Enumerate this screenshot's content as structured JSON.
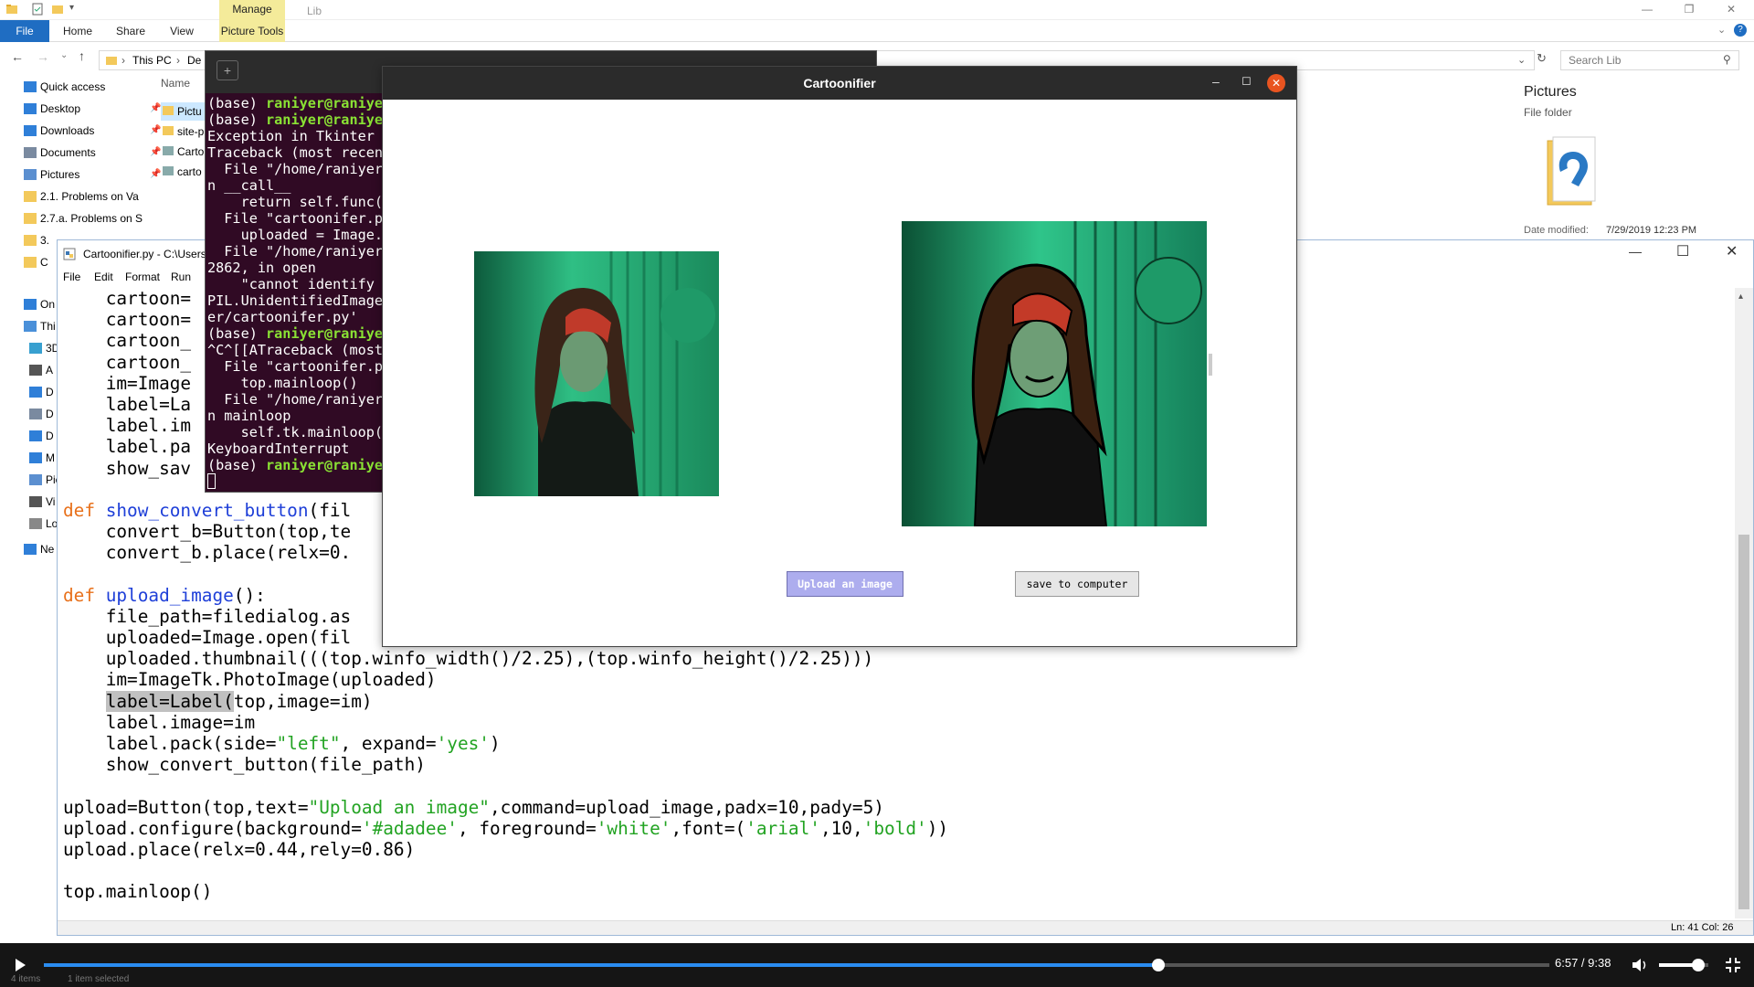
{
  "explorer": {
    "contextual_tab": "Manage",
    "window_title": "Lib",
    "tabs": [
      "File",
      "Home",
      "Share",
      "View",
      "Picture Tools"
    ],
    "breadcrumb": [
      "This PC",
      "De"
    ],
    "search_placeholder": "Search Lib",
    "name_column": "Name",
    "nav_items": [
      {
        "label": "Quick access",
        "icon": "star-icon"
      },
      {
        "label": "Desktop",
        "icon": "desktop-icon"
      },
      {
        "label": "Downloads",
        "icon": "download-icon"
      },
      {
        "label": "Documents",
        "icon": "documents-icon"
      },
      {
        "label": "Pictures",
        "icon": "pictures-icon"
      },
      {
        "label": "2.1. Problems on Va",
        "icon": "folder-icon"
      },
      {
        "label": "2.7.a. Problems on S",
        "icon": "folder-icon"
      },
      {
        "label": "3.",
        "icon": "folder-icon"
      },
      {
        "label": "C",
        "icon": "folder-icon"
      },
      {
        "label": "On",
        "icon": "cloud-icon"
      },
      {
        "label": "Thi",
        "icon": "computer-icon"
      },
      {
        "label": "3D",
        "icon": "3d-icon"
      },
      {
        "label": "A",
        "icon": "device-icon"
      },
      {
        "label": "D",
        "icon": "desktop-icon"
      },
      {
        "label": "D",
        "icon": "documents-icon"
      },
      {
        "label": "D",
        "icon": "download-icon"
      },
      {
        "label": "M",
        "icon": "music-icon"
      },
      {
        "label": "Pic",
        "icon": "pictures-icon"
      },
      {
        "label": "Vi",
        "icon": "video-icon"
      },
      {
        "label": "Lo",
        "icon": "drive-icon"
      },
      {
        "label": "Ne",
        "icon": "network-icon"
      }
    ],
    "files": [
      "Pictu",
      "site-p",
      "Carto",
      "carto"
    ],
    "details": {
      "title": "Pictures",
      "type": "File folder",
      "date_label": "Date modified:",
      "date_value": "7/29/2019 12:23 PM"
    },
    "status_items": "4 items",
    "status_selected": "1 item selected"
  },
  "idle": {
    "title": "Cartoonifier.py - C:\\Users",
    "menu": [
      "File",
      "Edit",
      "Format",
      "Run"
    ],
    "status": "Ln: 41   Col: 26",
    "code_lines": [
      [
        {
          "t": "    cartoon="
        }
      ],
      [
        {
          "t": "    cartoon="
        }
      ],
      [
        {
          "t": "    cartoon_"
        }
      ],
      [
        {
          "t": "    cartoon_"
        }
      ],
      [
        {
          "t": "    im=Image"
        }
      ],
      [
        {
          "t": "    label=La"
        }
      ],
      [
        {
          "t": "    label.im"
        }
      ],
      [
        {
          "t": "    label.pa"
        }
      ],
      [
        {
          "t": "    show_sav"
        }
      ],
      [
        {
          "t": ""
        }
      ],
      [
        {
          "t": "def ",
          "c": "kw"
        },
        {
          "t": "show_convert_button",
          "c": "fn"
        },
        {
          "t": "(fil"
        }
      ],
      [
        {
          "t": "    convert_b=Button(top,te"
        }
      ],
      [
        {
          "t": "    convert_b.place(relx=0."
        }
      ],
      [
        {
          "t": ""
        }
      ],
      [
        {
          "t": "def ",
          "c": "kw"
        },
        {
          "t": "upload_image",
          "c": "fn"
        },
        {
          "t": "():"
        }
      ],
      [
        {
          "t": "    file_path=filedialog.as"
        }
      ],
      [
        {
          "t": "    uploaded=Image.open(fil"
        }
      ],
      [
        {
          "t": "    uploaded.thumbnail(((top.winfo_width()/2.25),(top.winfo_height()/2.25)))"
        }
      ],
      [
        {
          "t": "    im=ImageTk.PhotoImage(uploaded)"
        }
      ],
      [
        {
          "t": "    "
        },
        {
          "t": "label=Label(",
          "c": "hl"
        },
        {
          "t": "top,image=im)"
        }
      ],
      [
        {
          "t": "    label.image=im"
        }
      ],
      [
        {
          "t": "    label.pack(side="
        },
        {
          "t": "\"left\"",
          "c": "str"
        },
        {
          "t": ", expand="
        },
        {
          "t": "'yes'",
          "c": "str"
        },
        {
          "t": ")"
        }
      ],
      [
        {
          "t": "    show_convert_button(file_path)"
        }
      ],
      [
        {
          "t": ""
        }
      ],
      [
        {
          "t": "upload=Button(top,text="
        },
        {
          "t": "\"Upload an image\"",
          "c": "str"
        },
        {
          "t": ",command=upload_image,padx=10,pady=5)"
        }
      ],
      [
        {
          "t": "upload.configure(background="
        },
        {
          "t": "'#adadee'",
          "c": "str"
        },
        {
          "t": ", foreground="
        },
        {
          "t": "'white'",
          "c": "str"
        },
        {
          "t": ",font=("
        },
        {
          "t": "'arial'",
          "c": "str"
        },
        {
          "t": ",10,"
        },
        {
          "t": "'bold'",
          "c": "str"
        },
        {
          "t": "))"
        }
      ],
      [
        {
          "t": "upload.place(relx=0.44,rely=0.86)"
        }
      ],
      [
        {
          "t": ""
        }
      ],
      [
        {
          "t": "top.mainloop()"
        }
      ]
    ]
  },
  "terminal": {
    "lines": [
      [
        {
          "t": "(base) "
        },
        {
          "t": "raniyer@raniyer",
          "c": "prompt"
        }
      ],
      [
        {
          "t": "(base) "
        },
        {
          "t": "raniyer@raniyer",
          "c": "prompt"
        }
      ],
      [
        {
          "t": "Exception in Tkinter c"
        }
      ],
      [
        {
          "t": "Traceback (most recent"
        }
      ],
      [
        {
          "t": "  File \"/home/raniyer,"
        }
      ],
      [
        {
          "t": "n __call__"
        }
      ],
      [
        {
          "t": "    return self.func(*"
        }
      ],
      [
        {
          "t": "  File \"cartoonifer.py"
        }
      ],
      [
        {
          "t": "    uploaded = Image.c"
        }
      ],
      [
        {
          "t": "  File \"/home/raniyer,"
        }
      ],
      [
        {
          "t": "2862, in open"
        }
      ],
      [
        {
          "t": "    \"cannot identify "
        }
      ],
      [
        {
          "t": "PIL.UnidentifiedImageE"
        }
      ],
      [
        {
          "t": "er/cartoonifer.py'"
        }
      ],
      [
        {
          "t": "(base) "
        },
        {
          "t": "raniyer@raniyer",
          "c": "prompt"
        }
      ],
      [
        {
          "t": "^C^[[ATraceback (most"
        }
      ],
      [
        {
          "t": "  File \"cartoonifer.py"
        }
      ],
      [
        {
          "t": "    top.mainloop()"
        }
      ],
      [
        {
          "t": "  File \"/home/raniyer,"
        }
      ],
      [
        {
          "t": "n mainloop"
        }
      ],
      [
        {
          "t": "    self.tk.mainloop(n"
        }
      ],
      [
        {
          "t": "KeyboardInterrupt"
        }
      ],
      [
        {
          "t": "(base) "
        },
        {
          "t": "raniyer@raniyer",
          "c": "prompt"
        }
      ]
    ]
  },
  "tk": {
    "title": "Cartoonifier",
    "upload_label": "Upload an image",
    "save_label": "save to computer"
  },
  "player": {
    "time": "6:57 / 9:38",
    "progress": 0.74,
    "volume": 0.8
  }
}
